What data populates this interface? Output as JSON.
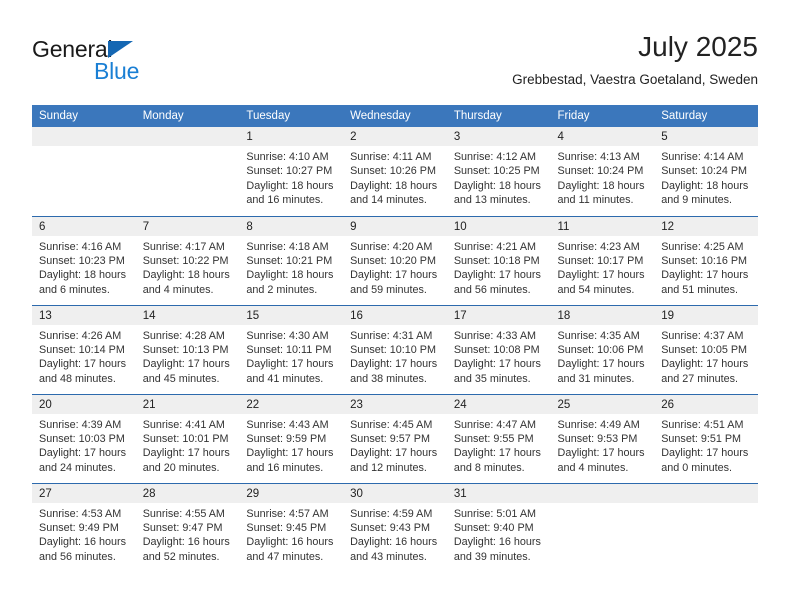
{
  "brand": {
    "name_part1": "General",
    "name_part2": "Blue",
    "accent_color": "#1467b3",
    "blue_text_color": "#1a7fd4"
  },
  "header": {
    "title": "July 2025",
    "subtitle": "Grebbestad, Vaestra Goetaland, Sweden"
  },
  "theme": {
    "header_bg": "#3b77bc",
    "row_divider": "#2d6aad",
    "date_band_bg": "#efefef"
  },
  "weekdays": [
    "Sunday",
    "Monday",
    "Tuesday",
    "Wednesday",
    "Thursday",
    "Friday",
    "Saturday"
  ],
  "labels": {
    "sunrise_prefix": "Sunrise:",
    "sunset_prefix": "Sunset:",
    "daylight_prefix": "Daylight:"
  },
  "weeks": [
    [
      {
        "day": "",
        "empty": true
      },
      {
        "day": "",
        "empty": true
      },
      {
        "day": "1",
        "sunrise": "Sunrise: 4:10 AM",
        "sunset": "Sunset: 10:27 PM",
        "daylight": "Daylight: 18 hours and 16 minutes."
      },
      {
        "day": "2",
        "sunrise": "Sunrise: 4:11 AM",
        "sunset": "Sunset: 10:26 PM",
        "daylight": "Daylight: 18 hours and 14 minutes."
      },
      {
        "day": "3",
        "sunrise": "Sunrise: 4:12 AM",
        "sunset": "Sunset: 10:25 PM",
        "daylight": "Daylight: 18 hours and 13 minutes."
      },
      {
        "day": "4",
        "sunrise": "Sunrise: 4:13 AM",
        "sunset": "Sunset: 10:24 PM",
        "daylight": "Daylight: 18 hours and 11 minutes."
      },
      {
        "day": "5",
        "sunrise": "Sunrise: 4:14 AM",
        "sunset": "Sunset: 10:24 PM",
        "daylight": "Daylight: 18 hours and 9 minutes."
      }
    ],
    [
      {
        "day": "6",
        "sunrise": "Sunrise: 4:16 AM",
        "sunset": "Sunset: 10:23 PM",
        "daylight": "Daylight: 18 hours and 6 minutes."
      },
      {
        "day": "7",
        "sunrise": "Sunrise: 4:17 AM",
        "sunset": "Sunset: 10:22 PM",
        "daylight": "Daylight: 18 hours and 4 minutes."
      },
      {
        "day": "8",
        "sunrise": "Sunrise: 4:18 AM",
        "sunset": "Sunset: 10:21 PM",
        "daylight": "Daylight: 18 hours and 2 minutes."
      },
      {
        "day": "9",
        "sunrise": "Sunrise: 4:20 AM",
        "sunset": "Sunset: 10:20 PM",
        "daylight": "Daylight: 17 hours and 59 minutes."
      },
      {
        "day": "10",
        "sunrise": "Sunrise: 4:21 AM",
        "sunset": "Sunset: 10:18 PM",
        "daylight": "Daylight: 17 hours and 56 minutes."
      },
      {
        "day": "11",
        "sunrise": "Sunrise: 4:23 AM",
        "sunset": "Sunset: 10:17 PM",
        "daylight": "Daylight: 17 hours and 54 minutes."
      },
      {
        "day": "12",
        "sunrise": "Sunrise: 4:25 AM",
        "sunset": "Sunset: 10:16 PM",
        "daylight": "Daylight: 17 hours and 51 minutes."
      }
    ],
    [
      {
        "day": "13",
        "sunrise": "Sunrise: 4:26 AM",
        "sunset": "Sunset: 10:14 PM",
        "daylight": "Daylight: 17 hours and 48 minutes."
      },
      {
        "day": "14",
        "sunrise": "Sunrise: 4:28 AM",
        "sunset": "Sunset: 10:13 PM",
        "daylight": "Daylight: 17 hours and 45 minutes."
      },
      {
        "day": "15",
        "sunrise": "Sunrise: 4:30 AM",
        "sunset": "Sunset: 10:11 PM",
        "daylight": "Daylight: 17 hours and 41 minutes."
      },
      {
        "day": "16",
        "sunrise": "Sunrise: 4:31 AM",
        "sunset": "Sunset: 10:10 PM",
        "daylight": "Daylight: 17 hours and 38 minutes."
      },
      {
        "day": "17",
        "sunrise": "Sunrise: 4:33 AM",
        "sunset": "Sunset: 10:08 PM",
        "daylight": "Daylight: 17 hours and 35 minutes."
      },
      {
        "day": "18",
        "sunrise": "Sunrise: 4:35 AM",
        "sunset": "Sunset: 10:06 PM",
        "daylight": "Daylight: 17 hours and 31 minutes."
      },
      {
        "day": "19",
        "sunrise": "Sunrise: 4:37 AM",
        "sunset": "Sunset: 10:05 PM",
        "daylight": "Daylight: 17 hours and 27 minutes."
      }
    ],
    [
      {
        "day": "20",
        "sunrise": "Sunrise: 4:39 AM",
        "sunset": "Sunset: 10:03 PM",
        "daylight": "Daylight: 17 hours and 24 minutes."
      },
      {
        "day": "21",
        "sunrise": "Sunrise: 4:41 AM",
        "sunset": "Sunset: 10:01 PM",
        "daylight": "Daylight: 17 hours and 20 minutes."
      },
      {
        "day": "22",
        "sunrise": "Sunrise: 4:43 AM",
        "sunset": "Sunset: 9:59 PM",
        "daylight": "Daylight: 17 hours and 16 minutes."
      },
      {
        "day": "23",
        "sunrise": "Sunrise: 4:45 AM",
        "sunset": "Sunset: 9:57 PM",
        "daylight": "Daylight: 17 hours and 12 minutes."
      },
      {
        "day": "24",
        "sunrise": "Sunrise: 4:47 AM",
        "sunset": "Sunset: 9:55 PM",
        "daylight": "Daylight: 17 hours and 8 minutes."
      },
      {
        "day": "25",
        "sunrise": "Sunrise: 4:49 AM",
        "sunset": "Sunset: 9:53 PM",
        "daylight": "Daylight: 17 hours and 4 minutes."
      },
      {
        "day": "26",
        "sunrise": "Sunrise: 4:51 AM",
        "sunset": "Sunset: 9:51 PM",
        "daylight": "Daylight: 17 hours and 0 minutes."
      }
    ],
    [
      {
        "day": "27",
        "sunrise": "Sunrise: 4:53 AM",
        "sunset": "Sunset: 9:49 PM",
        "daylight": "Daylight: 16 hours and 56 minutes."
      },
      {
        "day": "28",
        "sunrise": "Sunrise: 4:55 AM",
        "sunset": "Sunset: 9:47 PM",
        "daylight": "Daylight: 16 hours and 52 minutes."
      },
      {
        "day": "29",
        "sunrise": "Sunrise: 4:57 AM",
        "sunset": "Sunset: 9:45 PM",
        "daylight": "Daylight: 16 hours and 47 minutes."
      },
      {
        "day": "30",
        "sunrise": "Sunrise: 4:59 AM",
        "sunset": "Sunset: 9:43 PM",
        "daylight": "Daylight: 16 hours and 43 minutes."
      },
      {
        "day": "31",
        "sunrise": "Sunrise: 5:01 AM",
        "sunset": "Sunset: 9:40 PM",
        "daylight": "Daylight: 16 hours and 39 minutes."
      },
      {
        "day": "",
        "empty": true
      },
      {
        "day": "",
        "empty": true
      }
    ]
  ]
}
